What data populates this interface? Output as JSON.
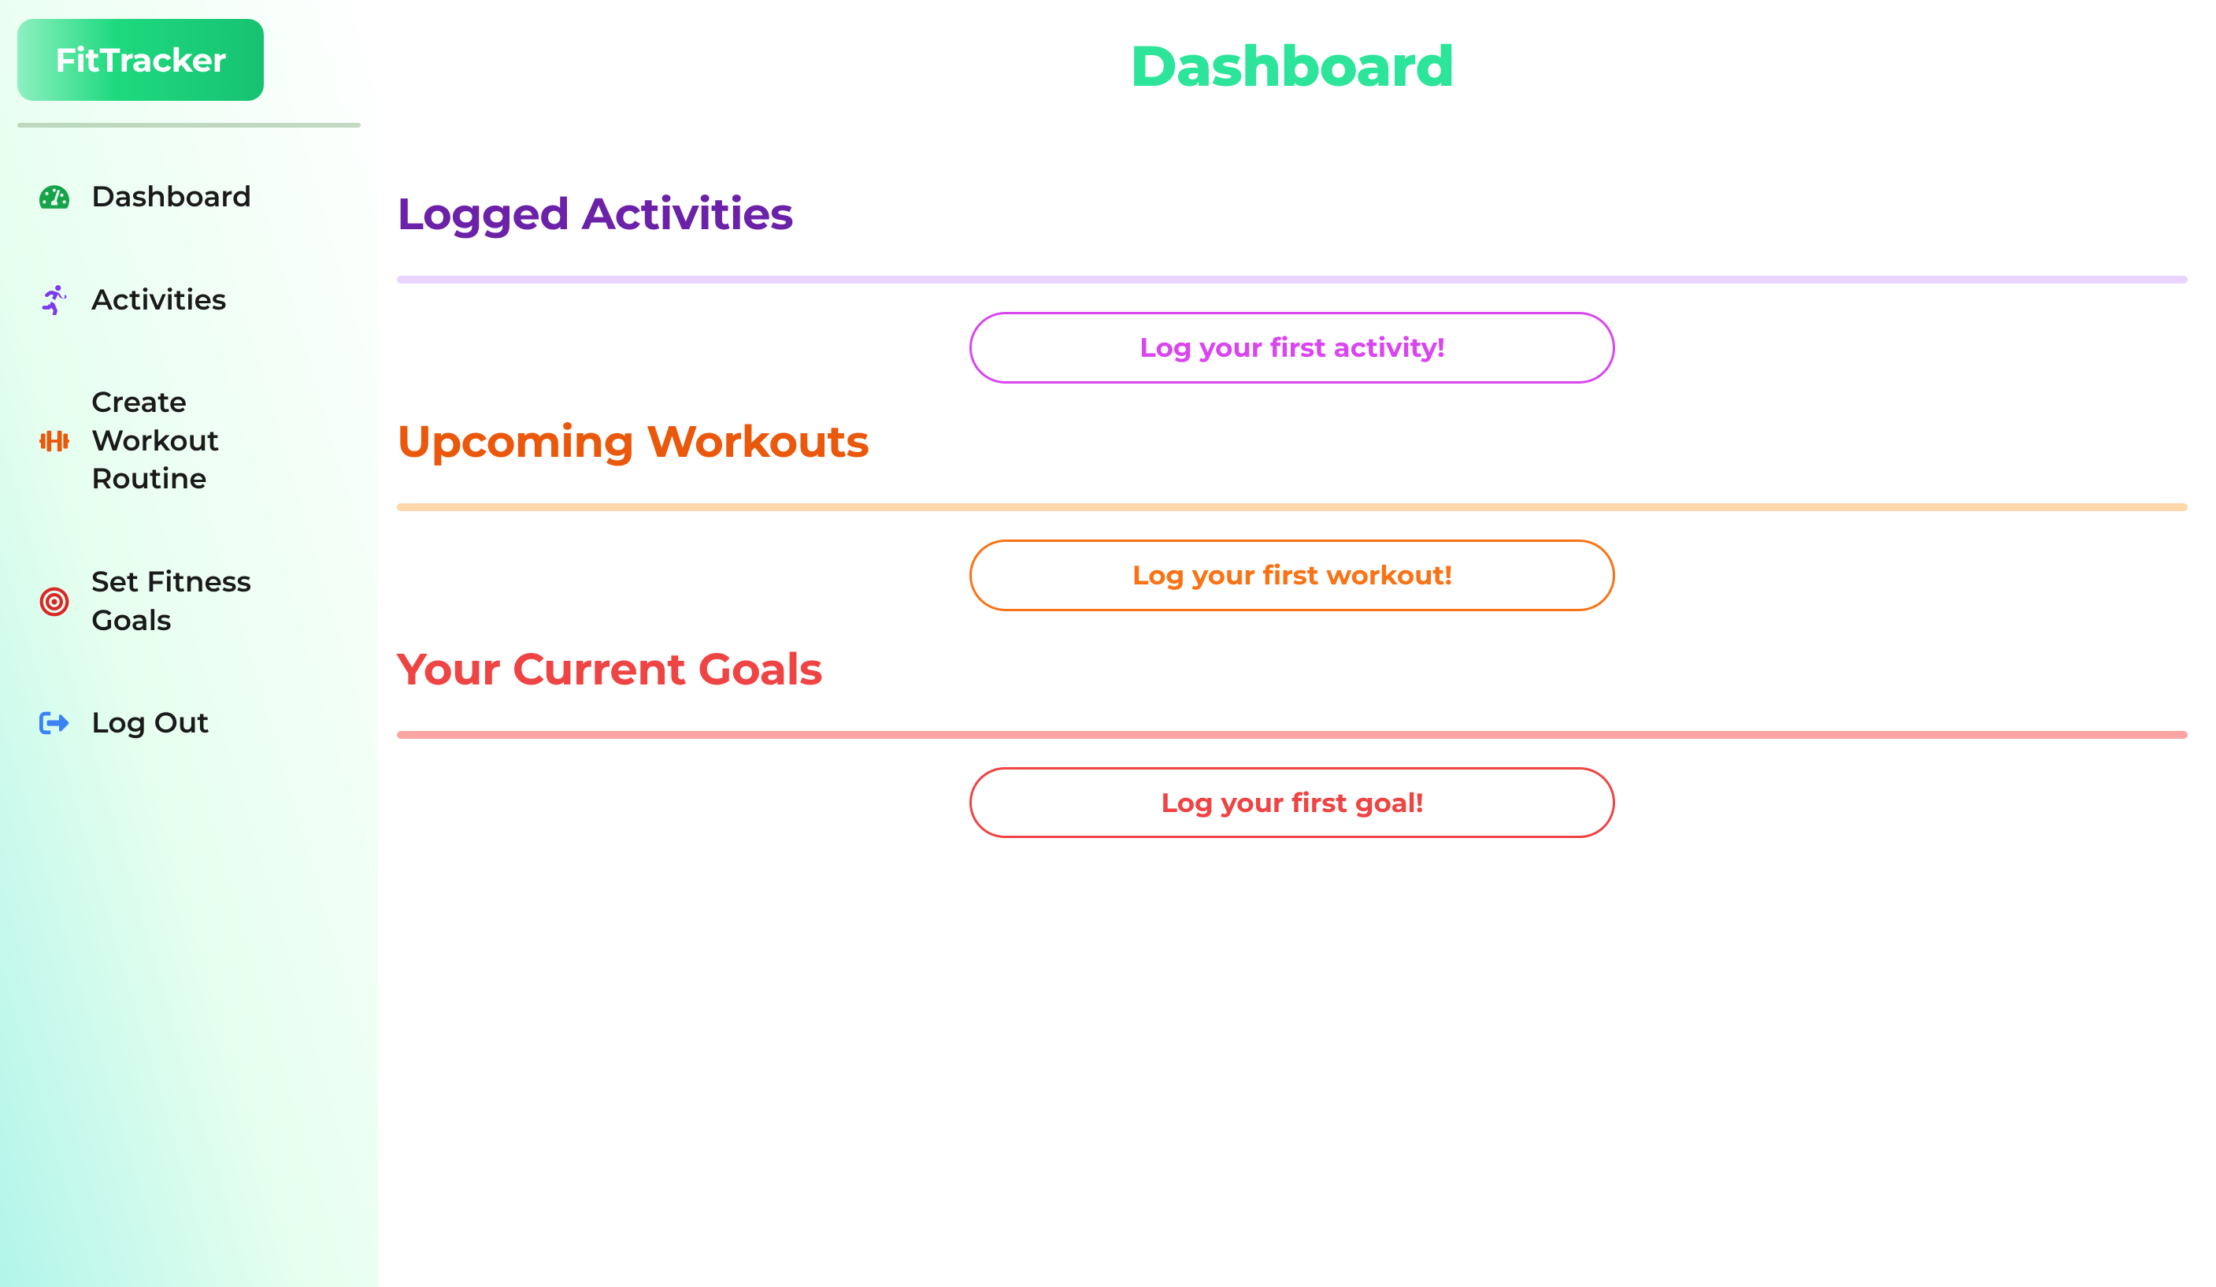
{
  "brand": "FitTracker",
  "page_title": "Dashboard",
  "sidebar": {
    "items": [
      {
        "label": "Dashboard",
        "icon": "dashboard-icon",
        "icon_color": "#16a34a"
      },
      {
        "label": "Activities",
        "icon": "running-icon",
        "icon_color": "#7c3aed"
      },
      {
        "label": "Create Workout Routine",
        "icon": "dumbbell-icon",
        "icon_color": "#ea580c"
      },
      {
        "label": "Set Fitness Goals",
        "icon": "bullseye-icon",
        "icon_color": "#dc2626"
      },
      {
        "label": "Log Out",
        "icon": "logout-icon",
        "icon_color": "#3b82f6"
      }
    ]
  },
  "sections": {
    "activities": {
      "title": "Logged Activities",
      "cta": "Log your first activity!",
      "color": "purple"
    },
    "workouts": {
      "title": "Upcoming Workouts",
      "cta": "Log your first workout!",
      "color": "orange"
    },
    "goals": {
      "title": "Your Current Goals",
      "cta": "Log your first goal!",
      "color": "red"
    }
  },
  "colors": {
    "brand_green": "#1ed97e",
    "purple": "#6b21a8",
    "purple_light": "#e9d5ff",
    "magenta": "#d946ef",
    "orange": "#ea580c",
    "orange_light": "#fed7aa",
    "red": "#ef4444",
    "red_light": "#fca5a5"
  }
}
